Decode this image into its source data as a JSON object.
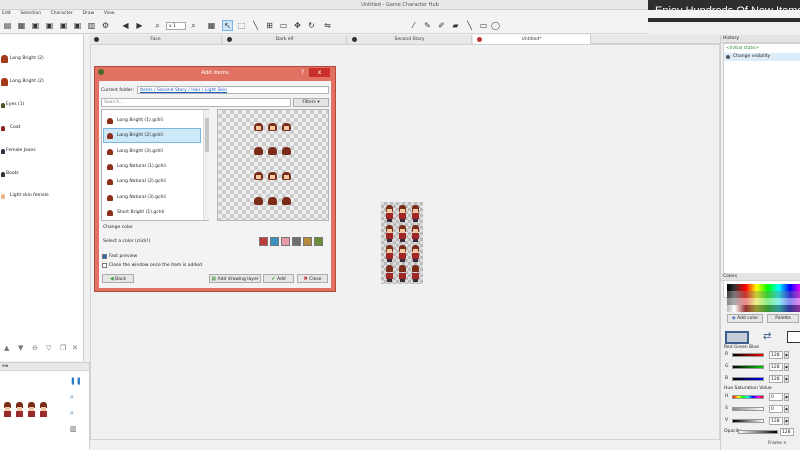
{
  "window": {
    "title": "Untitled - Game Character Hub"
  },
  "banner": {
    "text": "Enjoy Hundreds Of New Items"
  },
  "menu": [
    "Edit",
    "Selection",
    "Character",
    "Draw",
    "View"
  ],
  "toolbar": {
    "zoom": "x 1"
  },
  "tabs": [
    {
      "label": "Face"
    },
    {
      "label": "Dark elf"
    },
    {
      "label": "Second Story"
    },
    {
      "label": "Untitled*"
    }
  ],
  "layers": [
    {
      "label": "Long Bright (2)"
    },
    {
      "label": "Long Bright (2)"
    },
    {
      "label": "Eyes (1)"
    },
    {
      "label": "Coat"
    },
    {
      "label": "Female Jeans"
    },
    {
      "label": "Boots"
    },
    {
      "label": "Light skin female"
    }
  ],
  "dialog": {
    "title": "Add items",
    "help": "?",
    "close": "x",
    "folder_label": "Current folder:",
    "path": "Items / Second Story / Hair / Light Skin",
    "search_placeholder": "Search...",
    "filters_label": "Filters",
    "items": [
      {
        "label": "Long Bright (1).gchli",
        "selected": false
      },
      {
        "label": "Long Bright (2).gchli",
        "selected": true
      },
      {
        "label": "Long Bright (3).gchli",
        "selected": false
      },
      {
        "label": "Long Natural (1).gchli",
        "selected": false
      },
      {
        "label": "Long Natural (2).gchli",
        "selected": false
      },
      {
        "label": "Long Natural (3).gchli",
        "selected": false
      },
      {
        "label": "Short Bright (1).gchli",
        "selected": false
      }
    ],
    "change_color": "Change color",
    "select_color": "Select a color (click!)",
    "swatch_colors": [
      "#c23b3b",
      "#3b8fc2",
      "#e89aa6",
      "#6e6e6e",
      "#b5893a",
      "#6b8e3a"
    ],
    "fast_preview": {
      "label": "Fast preview",
      "checked": true
    },
    "close_window": {
      "label": "Close the window once the item is added",
      "checked": false
    },
    "back_label": "Back",
    "add_layer_label": "Add drawing layer",
    "add_label": "Add",
    "close_label": "Close"
  },
  "preview": {
    "title": "ew"
  },
  "history": {
    "title": "History",
    "initial": "<Initial state>",
    "entry": "Change visibility"
  },
  "colors": {
    "title": "Colors",
    "add_color": "Add color",
    "palette": "Palette",
    "rgb_title": "Red Green Blue",
    "r": {
      "key": "R",
      "value": "128"
    },
    "g": {
      "key": "G",
      "value": "128"
    },
    "b": {
      "key": "B",
      "value": "128"
    },
    "hsv_title": "Hue Saturation Value",
    "h": {
      "key": "H",
      "value": "0"
    },
    "s": {
      "key": "S",
      "value": "0"
    },
    "v": {
      "key": "V",
      "value": "128"
    },
    "opacity": {
      "key": "Opacity",
      "value": "128"
    }
  },
  "status": {
    "frame": "Frame n"
  }
}
